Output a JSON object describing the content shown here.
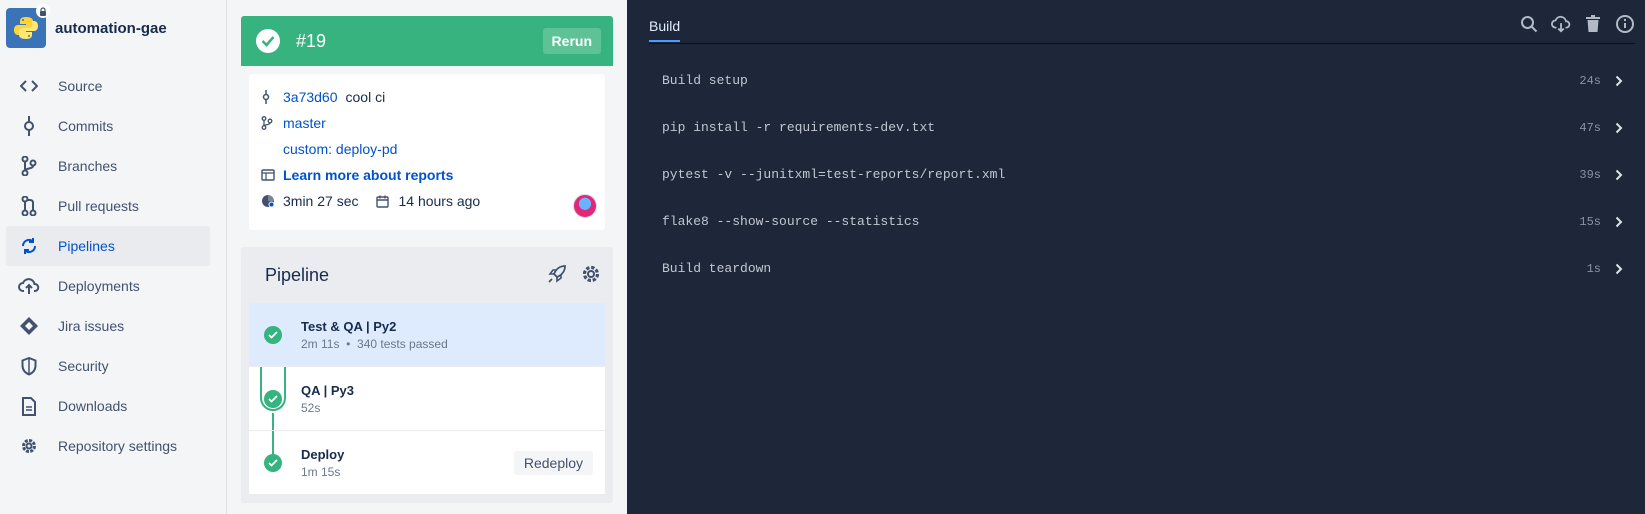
{
  "repo": {
    "name": "automation-gae"
  },
  "sidebar": {
    "items": [
      {
        "label": "Source"
      },
      {
        "label": "Commits"
      },
      {
        "label": "Branches"
      },
      {
        "label": "Pull requests"
      },
      {
        "label": "Pipelines"
      },
      {
        "label": "Deployments"
      },
      {
        "label": "Jira issues"
      },
      {
        "label": "Security"
      },
      {
        "label": "Downloads"
      },
      {
        "label": "Repository settings"
      }
    ],
    "active_index": 4
  },
  "status": {
    "number": "#19",
    "rerun_label": "Rerun",
    "color": "#36b37e",
    "commit_hash": "3a73d60",
    "commit_message": "cool ci",
    "branch": "master",
    "custom": "custom: deploy-pd",
    "reports_link": "Learn more about reports",
    "duration": "3min 27 sec",
    "time_ago": "14 hours ago"
  },
  "pipeline": {
    "title": "Pipeline",
    "steps": [
      {
        "name": "Test & QA | Py2",
        "duration": "2m 11s",
        "tests": "340 tests passed"
      },
      {
        "name": "QA | Py3",
        "duration": "52s"
      },
      {
        "name": "Deploy",
        "duration": "1m 15s",
        "action": "Redeploy"
      }
    ]
  },
  "build": {
    "tab": "Build",
    "commands": [
      {
        "cmd": "Build setup",
        "duration": "24s"
      },
      {
        "cmd": "pip install -r requirements-dev.txt",
        "duration": "47s"
      },
      {
        "cmd": "pytest -v --junitxml=test-reports/report.xml",
        "duration": "39s"
      },
      {
        "cmd": "flake8 --show-source --statistics",
        "duration": "15s"
      },
      {
        "cmd": "Build teardown",
        "duration": "1s"
      }
    ]
  }
}
